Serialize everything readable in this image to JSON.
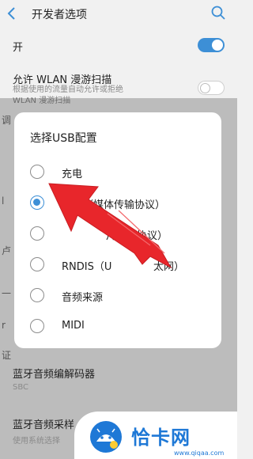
{
  "header": {
    "title": "开发者选项",
    "back_icon": "chevron-left-icon",
    "search_icon": "search-icon"
  },
  "settings": {
    "master_toggle_label": "开",
    "master_toggle_on": true,
    "wlan_roaming": {
      "label": "允许 WLAN 漫游扫描",
      "sub_line1": "根据使用的流量自动允许或拒绝",
      "sub_line2": "WLAN 漫游扫描",
      "on": false
    },
    "partial_letters": [
      "调",
      "l",
      "卢",
      "一",
      "r",
      "证"
    ]
  },
  "dialog": {
    "title": "选择USB配置",
    "options": [
      {
        "label": "充电",
        "checked": false
      },
      {
        "label": "MTP（媒体传输协议）",
        "checked": true
      },
      {
        "label": "片传输协议）",
        "checked": false
      },
      {
        "label": "RNDIS（U",
        "label_end": "太网）",
        "checked": false
      },
      {
        "label": "音频来源",
        "checked": false
      },
      {
        "label": "MIDI",
        "checked": false
      }
    ]
  },
  "bottom": {
    "codec_label": "蓝牙音频编解码器",
    "codec_value": "SBC",
    "sample_label": "蓝牙音频采样",
    "sample_sub": "使用系统选择"
  },
  "watermark": {
    "brand": "恰卡网",
    "url": "www.qiqaa.com"
  },
  "colors": {
    "accent": "#3d8fd6",
    "arrow": "#e8262b",
    "watermark": "#1e78d6"
  }
}
